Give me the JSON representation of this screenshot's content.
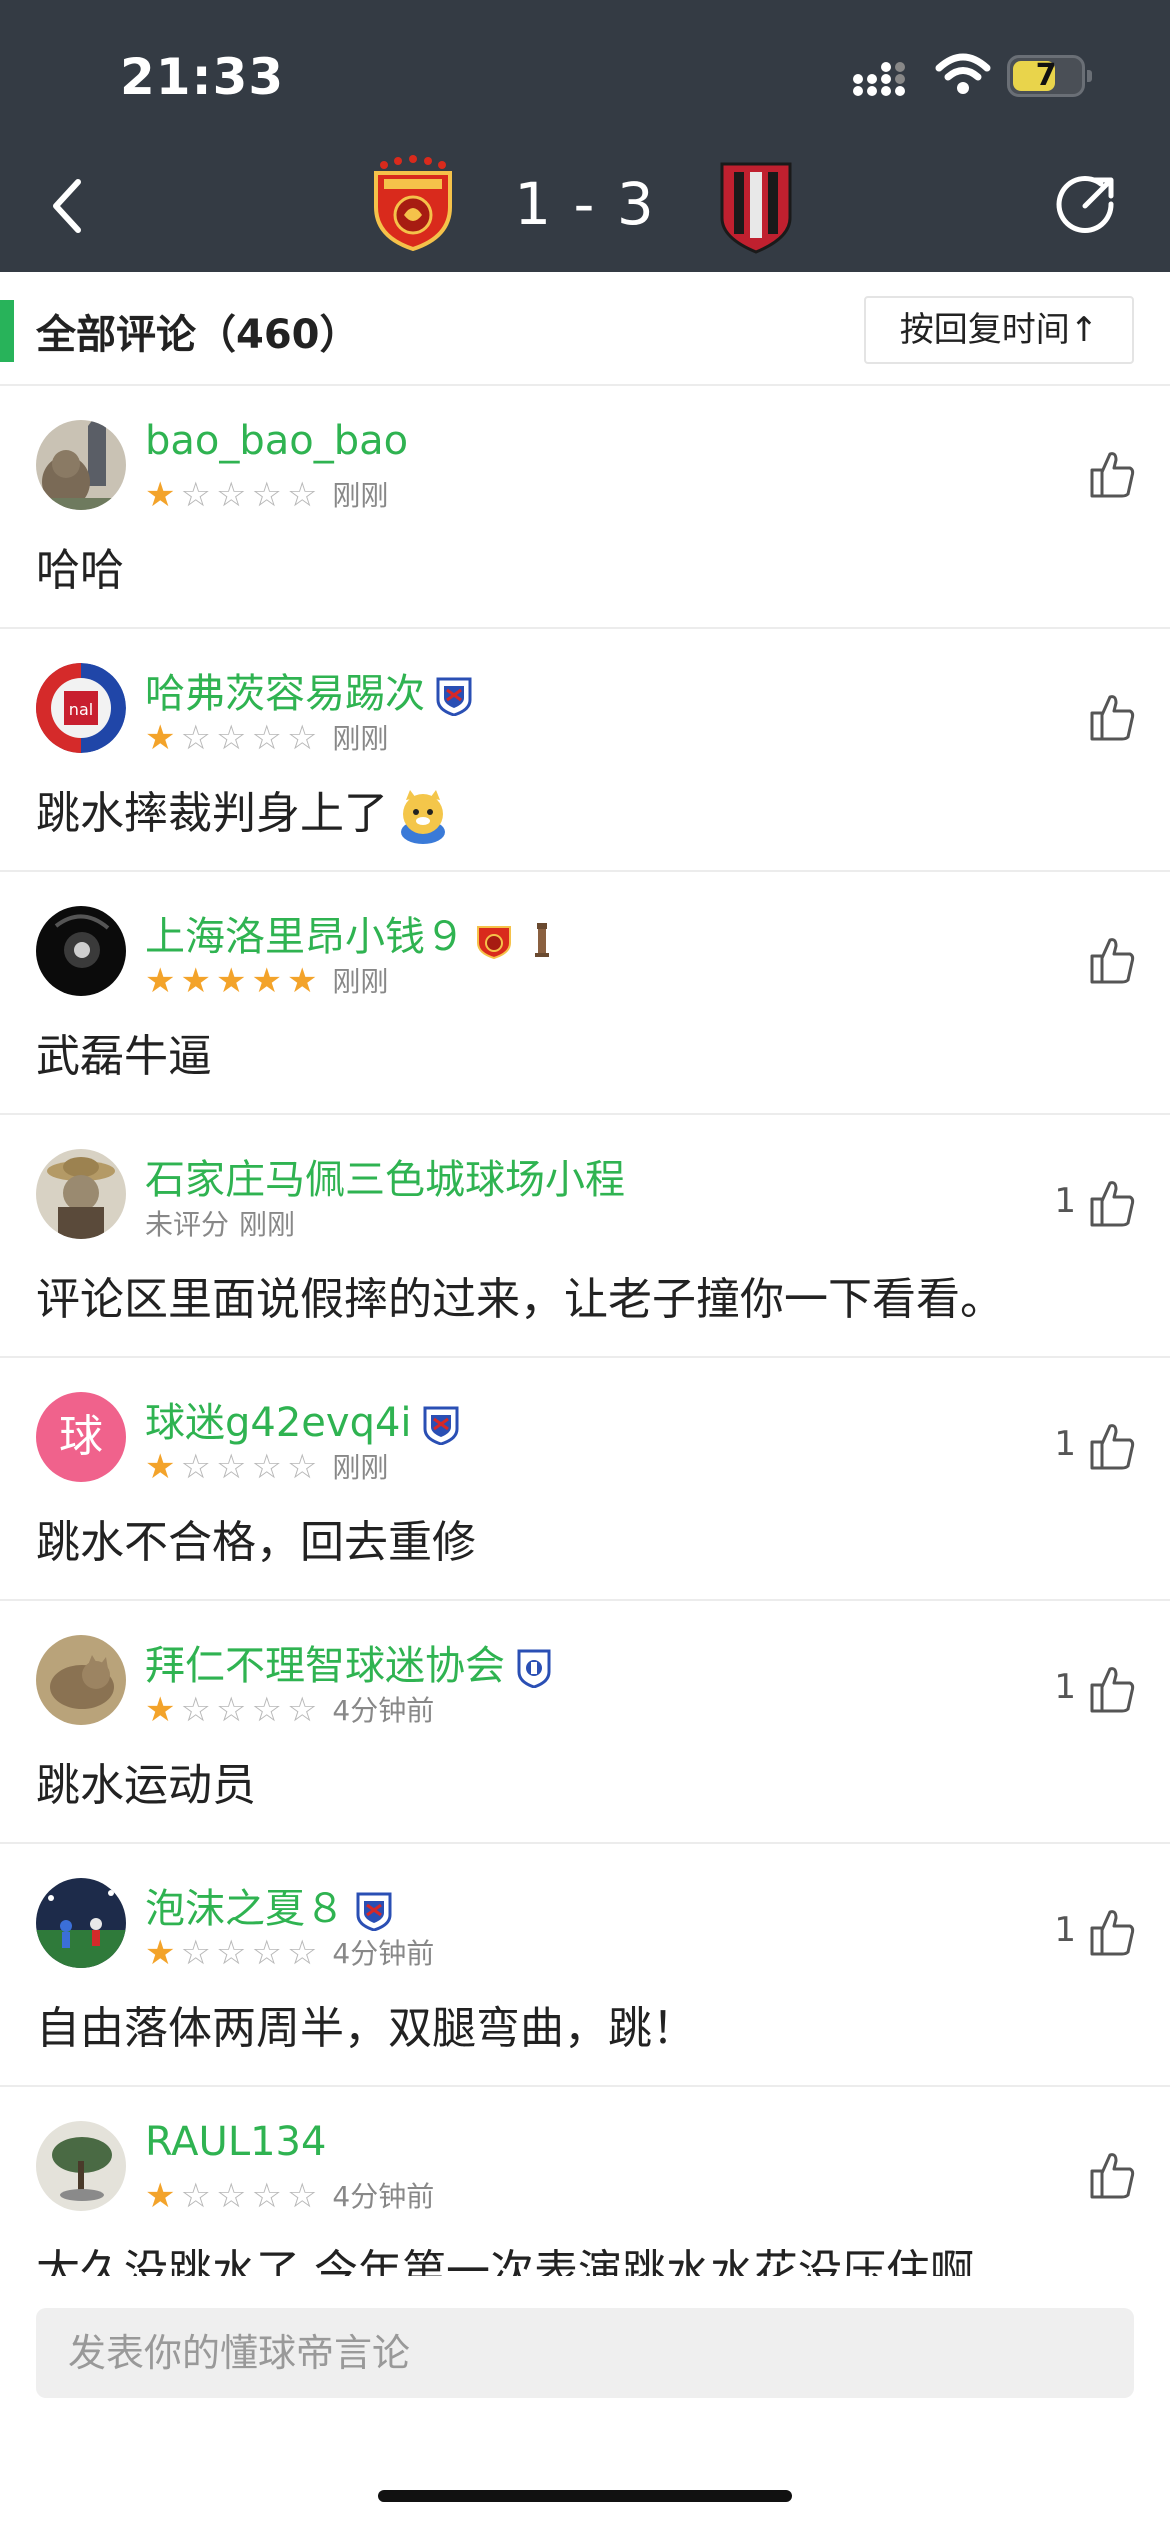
{
  "status": {
    "time": "21:33",
    "battery": "7"
  },
  "match": {
    "score": "1 - 3"
  },
  "comments_header": {
    "title": "全部评论（460）",
    "sort_label": "按回复时间↑"
  },
  "comments": [
    {
      "user": "bao_bao_bao",
      "stars": 1,
      "rating_text": "",
      "time": "刚刚",
      "text": "哈哈",
      "likes": "",
      "avatar": "photo-cat",
      "badges": []
    },
    {
      "user": "哈弗茨容易踢次",
      "stars": 1,
      "rating_text": "",
      "time": "刚刚",
      "text": "跳水摔裁判身上了",
      "likes": "",
      "avatar": "team-logo",
      "badges": [
        "shenhua-badge"
      ],
      "emoji": "doge-emoji"
    },
    {
      "user": "上海洛里昂小钱９",
      "stars": 5,
      "rating_text": "",
      "time": "刚刚",
      "text": "武磊牛逼",
      "likes": "",
      "avatar": "dark-photo",
      "badges": [
        "port-badge",
        "tower-badge"
      ]
    },
    {
      "user": "石家庄马佩三色城球场小程",
      "stars": 0,
      "rating_text": "未评分",
      "time": "刚刚",
      "text": "评论区里面说假摔的过来，让老子撞你一下看看。",
      "likes": "1",
      "avatar": "photo-dog",
      "badges": []
    },
    {
      "user": "球迷g42evq4i",
      "stars": 1,
      "rating_text": "",
      "time": "刚刚",
      "text": "跳水不合格，回去重修",
      "likes": "1",
      "avatar": "letter-avatar",
      "avatar_text": "球",
      "badges": [
        "shenhua-badge"
      ]
    },
    {
      "user": "拜仁不理智球迷协会",
      "stars": 1,
      "rating_text": "",
      "time": "4分钟前",
      "text": "跳水运动员",
      "likes": "1",
      "avatar": "photo-cat2",
      "badges": [
        "shield-badge"
      ]
    },
    {
      "user": "泡沫之夏８",
      "stars": 1,
      "rating_text": "",
      "time": "4分钟前",
      "text": "自由落体两周半，双腿弯曲，跳！",
      "likes": "1",
      "avatar": "photo-stadium",
      "badges": [
        "shenhua-badge"
      ]
    },
    {
      "user": "RAUL134",
      "stars": 1,
      "rating_text": "",
      "time": "4分钟前",
      "text": "太久没跳水了,今年第一次表演跳水水花没压住啊",
      "likes": "",
      "avatar": "photo-tree",
      "badges": []
    }
  ],
  "composer": {
    "placeholder": "发表你的懂球帝言论"
  },
  "colors": {
    "header_bg": "#343b44",
    "accent_green": "#2fb351",
    "star": "#f3a32a"
  }
}
